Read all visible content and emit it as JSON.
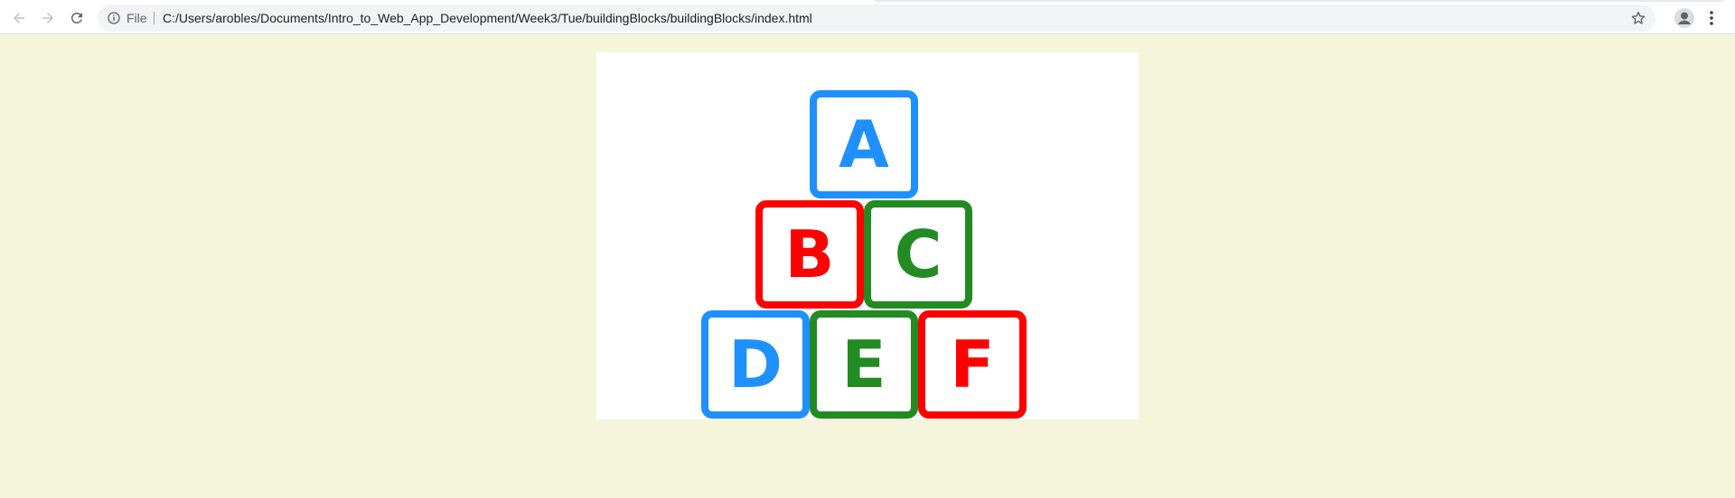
{
  "browser": {
    "scheme_label": "File",
    "url": "C:/Users/arobles/Documents/Intro_to_Web_App_Development/Week3/Tue/buildingBlocks/buildingBlocks/index.html",
    "icons": {
      "back": "back-arrow-icon",
      "forward": "forward-arrow-icon",
      "reload": "reload-icon",
      "info": "info-icon",
      "bookmark": "star-icon",
      "profile": "profile-icon",
      "menu": "kebab-menu-icon"
    }
  },
  "page": {
    "background": "#f5f5dc",
    "blocks": [
      {
        "letter": "A",
        "color": "#1e90ff"
      },
      {
        "letter": "B",
        "color": "#ff0000"
      },
      {
        "letter": "C",
        "color": "#228b22"
      },
      {
        "letter": "D",
        "color": "#1e90ff"
      },
      {
        "letter": "E",
        "color": "#228b22"
      },
      {
        "letter": "F",
        "color": "#ff0000"
      }
    ]
  }
}
